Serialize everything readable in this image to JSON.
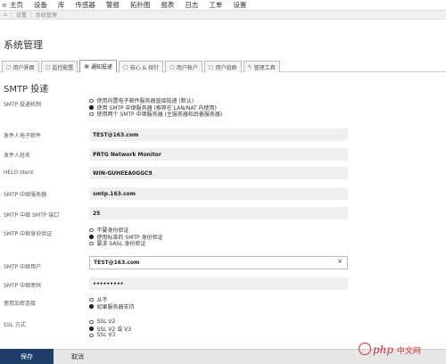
{
  "topnav": {
    "items": [
      "主页",
      "设备",
      "库",
      "传感器",
      "警报",
      "拓扑图",
      "报表",
      "日志",
      "工单",
      "设置"
    ]
  },
  "breadcrumb": {
    "home": "⌂",
    "items": [
      "设置",
      "系统管理"
    ]
  },
  "page_title": "系统管理",
  "tabs": [
    {
      "label": "用户界面",
      "icon": "▢"
    },
    {
      "label": "监控配置",
      "icon": "▢"
    },
    {
      "label": "通知投递",
      "icon": "▣"
    },
    {
      "label": "核心 & 探针",
      "icon": "▢"
    },
    {
      "label": "用户帐户",
      "icon": "▢"
    },
    {
      "label": "用户组群",
      "icon": "▢"
    },
    {
      "label": "管理工具",
      "icon": "✎"
    }
  ],
  "section_title": "SMTP 投递",
  "form": {
    "delivery_mechanism": {
      "label": "SMTP 投递机制",
      "options": [
        {
          "label": "使用内置电子邮件服务器直接投递 (默认)",
          "selected": false
        },
        {
          "label": "使用 SMTP 中继服务器 (推荐在 LAN/NAT 内使用)",
          "selected": true
        },
        {
          "label": "使用两个 SMTP 中继服务器 (主服务器和后备服务器)",
          "selected": false
        }
      ]
    },
    "sender_email": {
      "label": "发件人电子邮件",
      "value": "TEST@163.com"
    },
    "sender_name": {
      "label": "发件人姓名",
      "value": "PRTG Network Monitor"
    },
    "helo_ident": {
      "label": "HELO Ident",
      "value": "WIN-GUHEEA0GGC9"
    },
    "smtp_relay_server": {
      "label": "SMTP 中继服务器",
      "value": "smtp.163.com"
    },
    "smtp_relay_port": {
      "label": "SMTP 中继 SMTP 端口",
      "value": "25"
    },
    "smtp_auth": {
      "label": "SMTP 中继身份验证",
      "options": [
        {
          "label": "不要身份验证",
          "selected": false
        },
        {
          "label": "使用标准的 SMTP 身份验证",
          "selected": true
        },
        {
          "label": "要求 SASL 身份验证",
          "selected": false
        }
      ]
    },
    "smtp_user": {
      "label": "SMTP 中继用户",
      "value": "TEST@163.com",
      "clear": "×"
    },
    "smtp_password": {
      "label": "SMTP 中继密码",
      "value": "•••••••••"
    },
    "encryption": {
      "label": "使用加密连接",
      "options": [
        {
          "label": "从不",
          "selected": false
        },
        {
          "label": "如果服务器支持",
          "selected": true
        }
      ]
    },
    "ssl_method": {
      "label": "SSL 方式",
      "options": [
        {
          "label": "SSL V2",
          "selected": false
        },
        {
          "label": "SSL V2 或 V3",
          "selected": true
        },
        {
          "label": "SSL V3",
          "selected": false
        }
      ]
    }
  },
  "footer": {
    "save": "保存",
    "cancel": "取消"
  },
  "watermark": {
    "logo": "php",
    "text": "中文网"
  }
}
